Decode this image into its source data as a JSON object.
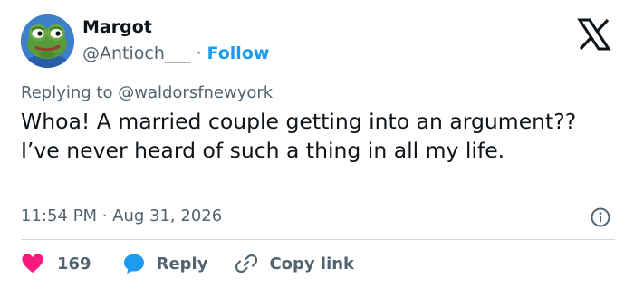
{
  "author": {
    "name": "Margot",
    "handle": "@Antioch___",
    "separator": "·",
    "follow_label": "Follow",
    "avatar_icon": "frog-avatar"
  },
  "brand": {
    "logo_icon": "x-logo-icon"
  },
  "replying": {
    "prefix": "Replying to",
    "mention": "@waldorsfnewyork"
  },
  "tweet": {
    "text": "Whoa! A married couple getting into an argument?? I’ve never heard of such a thing in all my life."
  },
  "meta": {
    "timestamp": "11:54 PM · Aug 31, 2026",
    "info_icon": "info-icon"
  },
  "actions": {
    "like_count": "169",
    "reply_label": "Reply",
    "copy_label": "Copy link"
  },
  "colors": {
    "accent": "#1d9bf0",
    "like": "#f91880",
    "muted": "#536471",
    "text": "#0f1419"
  }
}
